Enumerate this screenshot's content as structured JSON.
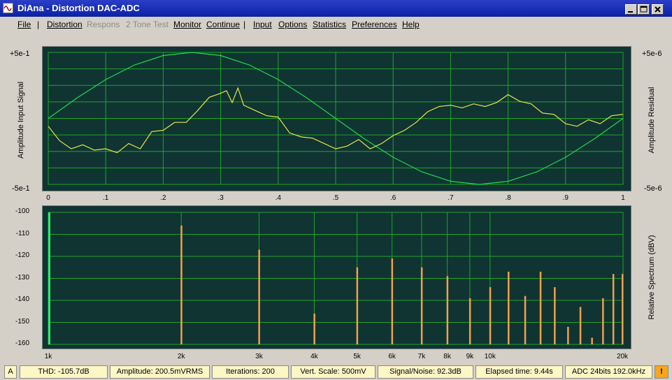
{
  "window": {
    "title": "DiAna - Distortion DAC-ADC"
  },
  "menu": {
    "file": "File",
    "distortion": "Distortion",
    "respons": "Respons",
    "two_tone": "2 Tone Test",
    "monitor": "Monitor",
    "continue": "Continue",
    "input": "Input",
    "options": "Options",
    "statistics": "Statistics",
    "preferences": "Preferences",
    "help": "Help",
    "separator": "|"
  },
  "upper_plot": {
    "left_top": "+5e-1",
    "left_bottom": "-5e-1",
    "left_label": "Amplitude Input Signal",
    "right_top": "+5e-6",
    "right_bottom": "-5e-6",
    "right_label": "Amplitude Residual",
    "x_ticks": [
      "0",
      ".1",
      ".2",
      ".3",
      ".4",
      ".5",
      ".6",
      ".7",
      ".8",
      ".9",
      "1"
    ]
  },
  "lower_plot": {
    "y_ticks": [
      "-100",
      "-110",
      "-120",
      "-130",
      "-140",
      "-150",
      "-160"
    ],
    "right_label": "Relative Spectrum (dBV)",
    "x_ticks": [
      "1k",
      "2k",
      "3k",
      "4k",
      "5k",
      "6k",
      "7k",
      "8k",
      "9k",
      "10k",
      "20k"
    ]
  },
  "chart_data": [
    {
      "type": "line",
      "xlim": [
        0,
        1
      ],
      "left_ylim": [
        -0.5,
        0.5
      ],
      "right_ylim": [
        -5e-06,
        5e-06
      ],
      "series": [
        {
          "axis": "left",
          "color": "#22d94a",
          "x": [
            0,
            0.05,
            0.1,
            0.15,
            0.2,
            0.25,
            0.3,
            0.35,
            0.4,
            0.45,
            0.5,
            0.55,
            0.6,
            0.65,
            0.7,
            0.75,
            0.8,
            0.85,
            0.9,
            0.95,
            1.0
          ],
          "values": [
            0,
            0.155,
            0.294,
            0.405,
            0.476,
            0.5,
            0.476,
            0.405,
            0.294,
            0.155,
            0,
            -0.155,
            -0.294,
            -0.405,
            -0.476,
            -0.5,
            -0.476,
            -0.405,
            -0.294,
            -0.155,
            0
          ]
        },
        {
          "axis": "right",
          "color": "#e6e64a",
          "x": [
            0,
            0.02,
            0.04,
            0.06,
            0.08,
            0.1,
            0.12,
            0.14,
            0.16,
            0.18,
            0.2,
            0.22,
            0.24,
            0.26,
            0.28,
            0.3,
            0.31,
            0.32,
            0.33,
            0.34,
            0.36,
            0.38,
            0.4,
            0.42,
            0.44,
            0.46,
            0.48,
            0.5,
            0.52,
            0.54,
            0.56,
            0.58,
            0.6,
            0.62,
            0.64,
            0.66,
            0.68,
            0.7,
            0.72,
            0.74,
            0.76,
            0.78,
            0.8,
            0.82,
            0.84,
            0.86,
            0.88,
            0.9,
            0.92,
            0.94,
            0.96,
            0.98,
            1.0
          ],
          "values": [
            -0.6,
            -1.7,
            -2.3,
            -2.0,
            -2.4,
            -2.3,
            -2.6,
            -1.9,
            -2.3,
            -1.0,
            -0.9,
            -0.3,
            -0.3,
            0.6,
            1.6,
            1.9,
            2.1,
            1.2,
            2.3,
            1.0,
            0.6,
            0.2,
            0.1,
            -1.1,
            -1.4,
            -1.5,
            -1.9,
            -2.3,
            -2.1,
            -1.6,
            -2.3,
            -1.9,
            -1.3,
            -0.9,
            -0.3,
            0.5,
            0.9,
            1.0,
            0.8,
            1.1,
            0.9,
            1.2,
            1.8,
            1.3,
            1.1,
            0.4,
            0.3,
            -0.4,
            -0.6,
            -0.1,
            -0.4,
            0.2,
            0.3
          ]
        }
      ]
    },
    {
      "type": "bar",
      "x_scale": "log",
      "xlim": [
        1000,
        20000
      ],
      "ylim": [
        -160,
        -100
      ],
      "categories": [
        "1k",
        "2k",
        "3k",
        "4k",
        "5k",
        "6k",
        "7k",
        "8k",
        "9k",
        "10k",
        "11k",
        "12k",
        "13k",
        "14k",
        "15k",
        "16k",
        "17k",
        "18k",
        "19k",
        "20k"
      ],
      "x": [
        1000,
        2000,
        3000,
        4000,
        5000,
        6000,
        7000,
        8000,
        9000,
        10000,
        11000,
        12000,
        13000,
        14000,
        15000,
        16000,
        17000,
        18000,
        19000,
        20000
      ],
      "values": [
        -100,
        -106,
        -117,
        -146,
        -125,
        -121,
        -125,
        -129,
        -139,
        -134,
        -127,
        -138,
        -127,
        -134,
        -152,
        -143,
        -157,
        -139,
        -128,
        -128
      ],
      "bar_color": "#f2a04c",
      "fundamental_color": "#2ee86a"
    }
  ],
  "status": {
    "mode": "A",
    "thd": "THD: -105.7dB",
    "amplitude": "Amplitude: 200.5mVRMS",
    "iterations": "Iterations: 200",
    "vert_scale": "Vert. Scale: 500mV",
    "signal_noise": "Signal/Noise:   92.3dB",
    "elapsed": "Elapsed time: 9.44s",
    "adc": "ADC 24bits 192.0kHz",
    "warn": "!"
  }
}
